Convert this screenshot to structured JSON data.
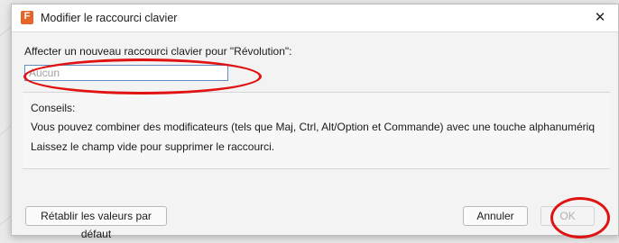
{
  "dialog": {
    "app_icon_letter": "F",
    "title": "Modifier le raccourci clavier",
    "close_glyph": "✕",
    "prompt": "Affecter un nouveau raccourci clavier pour \"Révolution\":",
    "shortcut_input": {
      "value": "",
      "placeholder": "Aucun"
    },
    "tips": {
      "title": "Conseils:",
      "line1": "Vous pouvez combiner des modificateurs (tels que Maj, Ctrl, Alt/Option et Commande) avec une touche alphanumériq",
      "line2": "Laissez le champ vide pour supprimer le raccourci."
    },
    "buttons": {
      "reset": "Rétablir les valeurs par défaut",
      "cancel": "Annuler",
      "ok": "OK"
    }
  },
  "icons": [
    "app-icon",
    "close-icon"
  ],
  "colors": {
    "app_icon": "#e8652a",
    "input_border": "#5b8fc6",
    "annotation": "#e01212",
    "ok_disabled_text": "#b0b0b0"
  },
  "states": {
    "ok_enabled": false
  }
}
